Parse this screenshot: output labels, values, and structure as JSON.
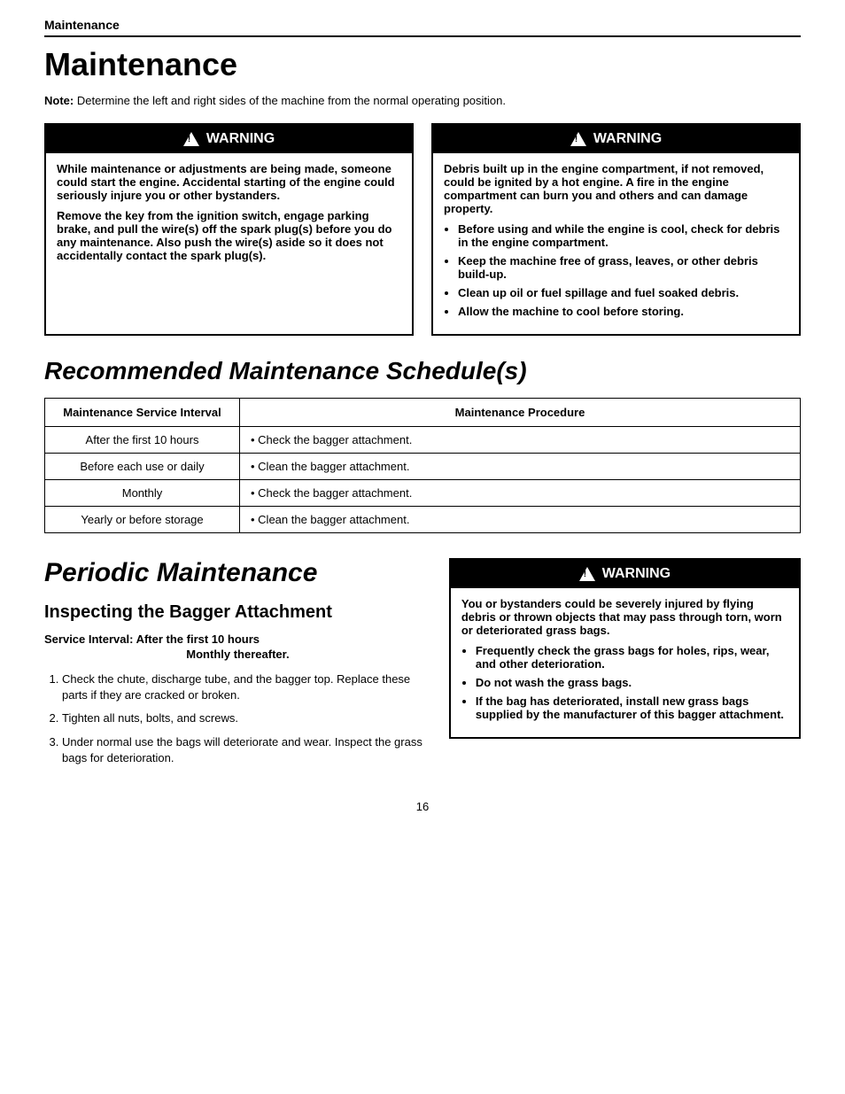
{
  "header": {
    "title": "Maintenance"
  },
  "page_title": "Maintenance",
  "note": {
    "label": "Note:",
    "text": "Determine the left and right sides of the machine from the normal operating position."
  },
  "warning1": {
    "header": "WARNING",
    "paragraphs": [
      "While maintenance or adjustments are being made, someone could start the engine. Accidental starting of the engine could seriously injure you or other bystanders.",
      "Remove the key from the ignition switch, engage parking brake, and pull the wire(s) off the spark plug(s) before you do any maintenance.  Also push the wire(s) aside so it does not accidentally contact the spark plug(s)."
    ]
  },
  "warning2": {
    "header": "WARNING",
    "intro": "Debris built up in the engine compartment, if not removed, could be ignited by a hot engine.  A fire in the engine compartment can burn you and others and can damage property.",
    "bullets": [
      "Before using and while the engine is cool, check for debris in the engine compartment.",
      "Keep the machine free of grass, leaves, or other debris build-up.",
      "Clean up oil or fuel spillage and fuel soaked debris.",
      "Allow the machine to cool before storing."
    ]
  },
  "recommended_title": "Recommended Maintenance Schedule(s)",
  "table": {
    "col1_header": "Maintenance Service Interval",
    "col2_header": "Maintenance Procedure",
    "rows": [
      {
        "interval": "After the first 10 hours",
        "procedure": "Check the bagger attachment."
      },
      {
        "interval": "Before each use or daily",
        "procedure": "Clean the bagger attachment."
      },
      {
        "interval": "Monthly",
        "procedure": "Check the bagger attachment."
      },
      {
        "interval": "Yearly or before storage",
        "procedure": "Clean the bagger attachment."
      }
    ]
  },
  "periodic": {
    "title": "Periodic Maintenance",
    "sub_title": "Inspecting the Bagger Attachment",
    "service_interval": "Service Interval:  After the first 10 hours",
    "monthly_thereafter": "Monthly thereafter.",
    "steps": [
      "Check the chute, discharge tube, and the bagger top.  Replace these parts if they are cracked or broken.",
      "Tighten all nuts, bolts, and screws.",
      "Under normal use the bags will deteriorate and wear.  Inspect the grass bags for deterioration."
    ]
  },
  "warning3": {
    "header": "WARNING",
    "intro": "You or bystanders could be severely injured by flying debris or thrown objects that may pass through torn, worn or deteriorated grass bags.",
    "bullets": [
      "Frequently check the grass bags for holes, rips, wear, and other deterioration.",
      "Do not wash the grass bags.",
      "If the bag has deteriorated, install new grass bags supplied by the manufacturer of this bagger attachment."
    ]
  },
  "page_number": "16"
}
